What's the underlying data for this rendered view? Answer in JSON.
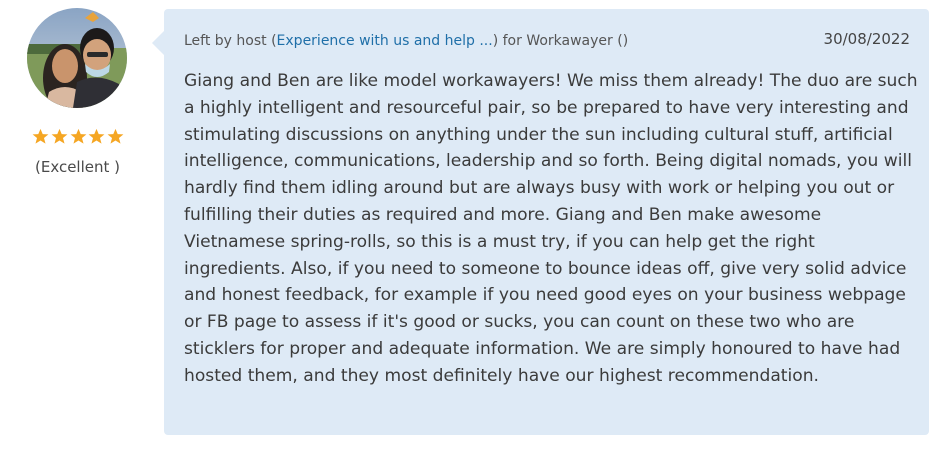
{
  "review": {
    "rating": {
      "stars": 5,
      "max_stars": 5,
      "label": "(Excellent )",
      "star_color": "#f5a623"
    },
    "meta": {
      "prefix": "Left by host (",
      "host_link": "Experience with us and help ...",
      "middle": ") for Workawayer (",
      "suffix": ")"
    },
    "date": "30/08/2022",
    "text": "Giang and Ben are like model workawayers! We miss them already! The duo are such a highly intelligent and resourceful pair, so be prepared to have very interesting and stimulating discussions on anything under the sun including cultural stuff, artificial intelligence, communications, leadership and so forth. Being digital nomads, you will hardly find them idling around but are always busy with work or helping you out or fulfilling their duties as required and more. Giang and Ben make awesome Vietnamese spring-rolls, so this is a must try, if you can help get the right ingredients. Also, if you need to someone to bounce ideas off, give very solid advice and honest feedback, for example if you need good eyes on your business webpage or FB page to assess if it's good or sucks, you can count on these two who are sticklers for proper and adequate information. We are simply honoured to have had hosted them, and they most definitely have our highest recommendation.",
    "bubble_color": "#deeaf6",
    "link_color": "#1f6fa8"
  }
}
